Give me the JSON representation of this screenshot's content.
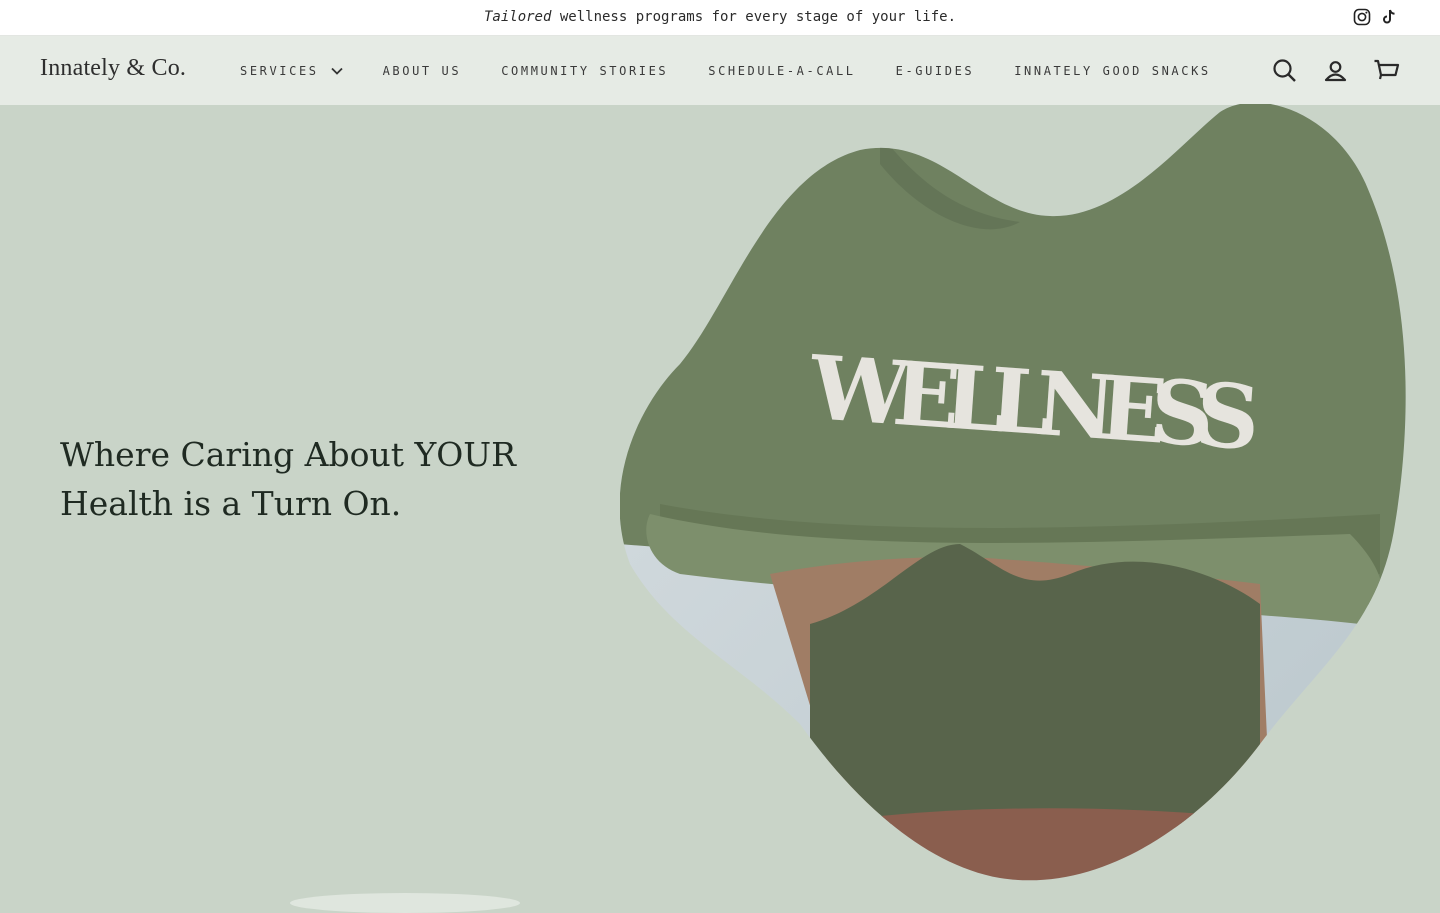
{
  "announcement": {
    "prefix_italic": "Tailored",
    "text": " wellness programs for every stage of your life."
  },
  "social": [
    {
      "icon": "instagram-icon"
    },
    {
      "icon": "tiktok-icon"
    }
  ],
  "header": {
    "logo": "Innately & Co.",
    "nav": [
      {
        "label": "SERVICES",
        "has_dropdown": true
      },
      {
        "label": "ABOUT US"
      },
      {
        "label": "COMMUNITY STORIES"
      },
      {
        "label": "SCHEDULE-A-CALL"
      },
      {
        "label": "E-GUIDES"
      },
      {
        "label": "INNATELY GOOD SNACKS"
      }
    ],
    "icons": [
      "search-icon",
      "account-icon",
      "cart-icon"
    ]
  },
  "hero": {
    "title": "Where Caring About YOUR Health is a Turn On.",
    "image_text": "WELLNESS"
  },
  "colors": {
    "background": "#c9d4c8",
    "header_bg": "#e6ebe5",
    "text_dark": "#1f2a22",
    "sweatshirt_green": "#6f8160"
  }
}
